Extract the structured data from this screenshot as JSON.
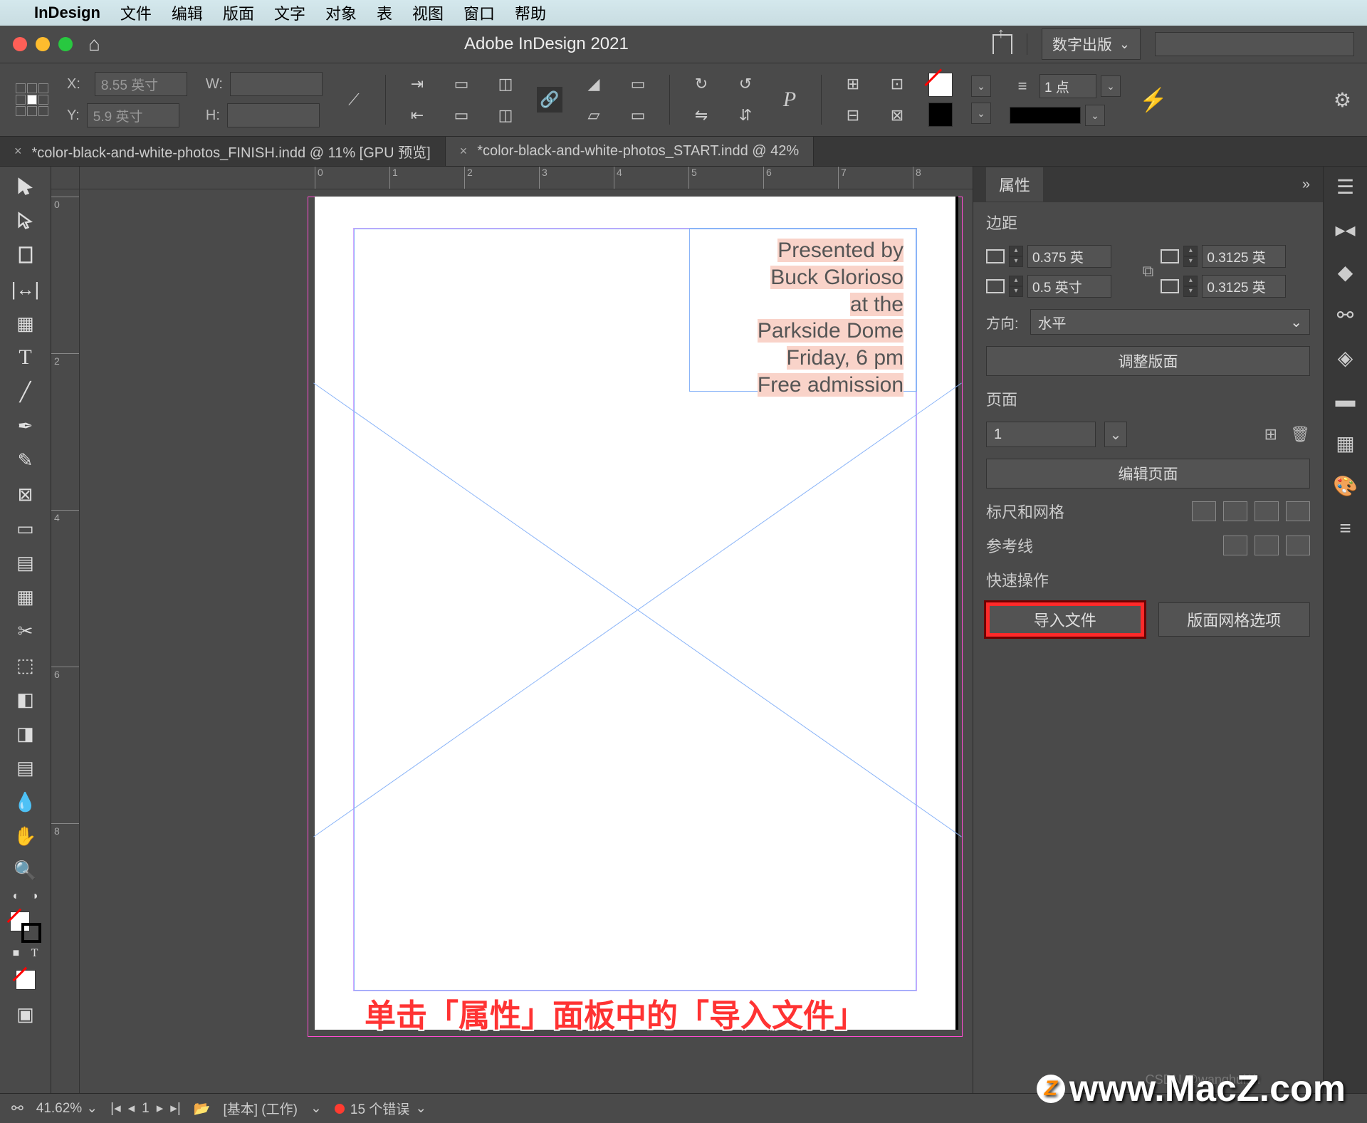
{
  "mac_menu": {
    "app": "InDesign",
    "items": [
      "文件",
      "编辑",
      "版面",
      "文字",
      "对象",
      "表",
      "视图",
      "窗口",
      "帮助"
    ]
  },
  "title_bar": {
    "title": "Adobe InDesign 2021",
    "workspace": "数字出版"
  },
  "control_bar": {
    "x_label": "X:",
    "x_value": "8.55 英寸",
    "y_label": "Y:",
    "y_value": "5.9 英寸",
    "w_label": "W:",
    "w_value": "",
    "h_label": "H:",
    "h_value": "",
    "stroke_weight": "1 点"
  },
  "tabs": [
    {
      "label": "*color-black-and-white-photos_FINISH.indd @ 11% [GPU 预览]",
      "active": false
    },
    {
      "label": "*color-black-and-white-photos_START.indd @ 42%",
      "active": true
    }
  ],
  "canvas": {
    "ruler_h": [
      "0",
      "1",
      "2",
      "3",
      "4",
      "5",
      "6",
      "7",
      "8"
    ],
    "ruler_v": [
      "0",
      "2",
      "4",
      "6",
      "8"
    ],
    "text_lines": [
      "Presented by",
      "Buck Glorioso",
      "at the",
      "Parkside Dome",
      "Friday, 6 pm",
      "Free admission"
    ],
    "hint": "单击「属性」面板中的「导入文件」"
  },
  "properties": {
    "panel_title": "属性",
    "margins_label": "边距",
    "margins": {
      "top": "0.375 英",
      "bottom": "0.5 英寸",
      "left": "0.3125 英",
      "right": "0.3125 英"
    },
    "orientation_label": "方向:",
    "orientation_value": "水平",
    "adjust_layout": "调整版面",
    "page_label": "页面",
    "page_value": "1",
    "edit_page": "编辑页面",
    "rulers_grid_label": "标尺和网格",
    "guides_label": "参考线",
    "quick_ops_label": "快速操作",
    "import_file": "导入文件",
    "grid_options": "版面网格选项"
  },
  "status": {
    "zoom": "41.62%",
    "master": "[基本] (工作)",
    "preflight": "15 个错误"
  },
  "watermark": "www.MacZ.com",
  "csdn": "CSDN @wanghui1h"
}
